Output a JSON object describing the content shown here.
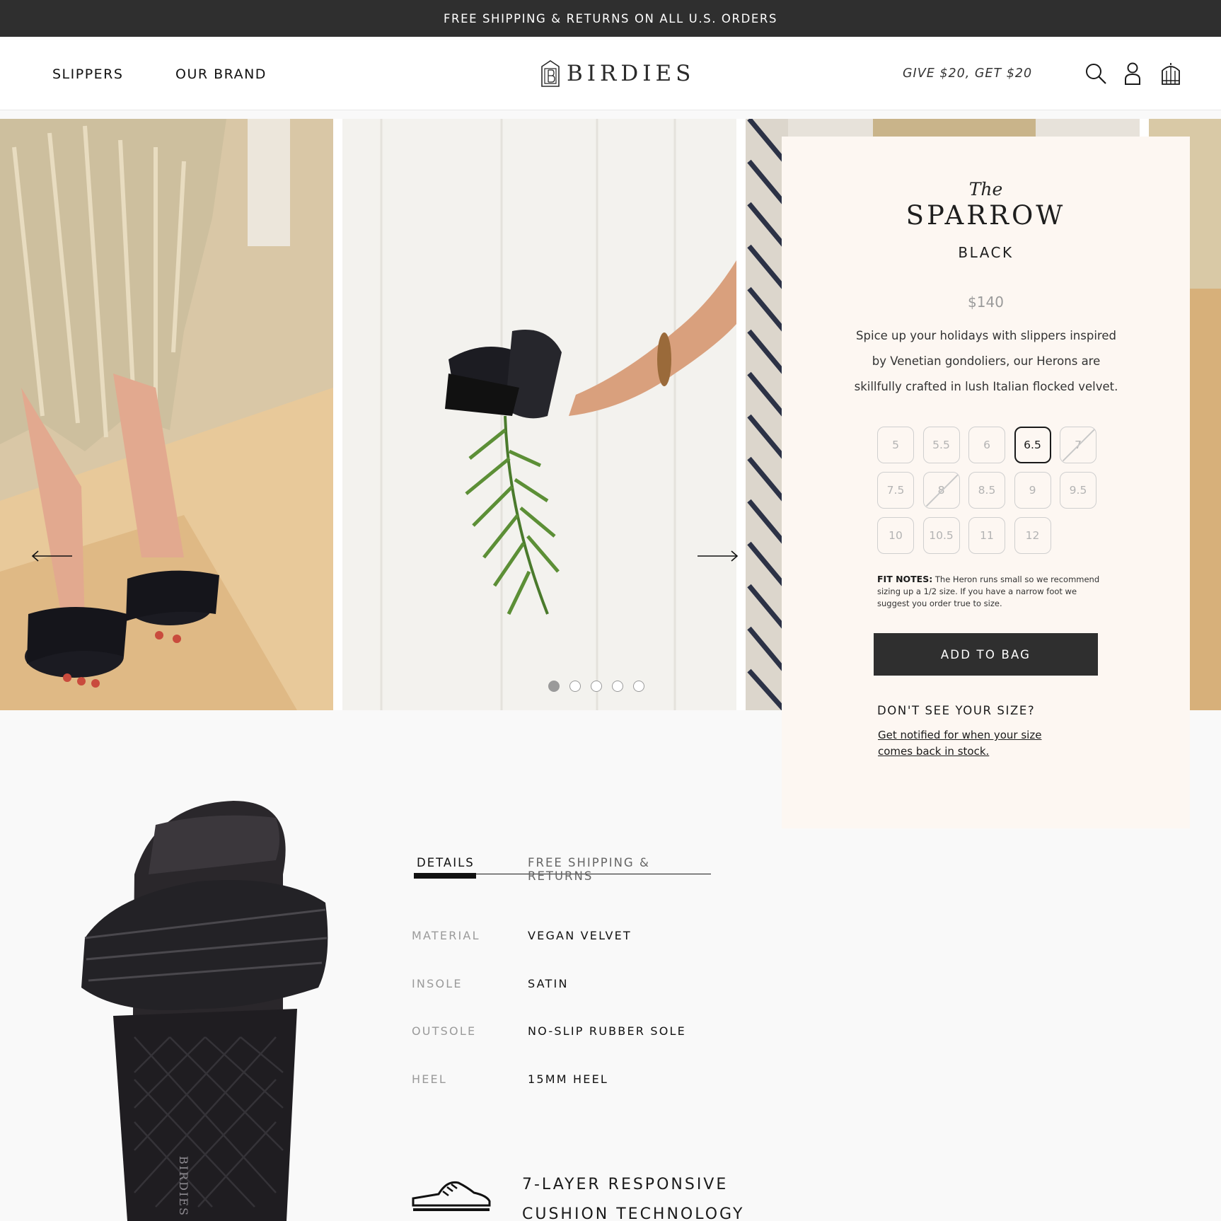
{
  "announcement": "FREE SHIPPING & RETURNS ON ALL U.S. ORDERS",
  "nav": {
    "slippers": "SLIPPERS",
    "our_brand": "OUR BRAND",
    "logo": "BIRDIES",
    "promo": "GIVE $20, GET $20",
    "icons": [
      "search-icon",
      "account-icon",
      "bag-icon"
    ]
  },
  "gallery": {
    "slide_count": 5,
    "active_slide": 1
  },
  "product": {
    "prefix": "The",
    "name": "SPARROW",
    "color": "BLACK",
    "price": "$140",
    "description": "Spice up your holidays with slippers inspired by Venetian gondoliers, our Herons are skillfully crafted in lush Italian flocked velvet.",
    "sizes": [
      {
        "label": "5",
        "state": "available"
      },
      {
        "label": "5.5",
        "state": "available"
      },
      {
        "label": "6",
        "state": "available"
      },
      {
        "label": "6.5",
        "state": "selected"
      },
      {
        "label": "7",
        "state": "sold-out"
      },
      {
        "label": "7.5",
        "state": "available"
      },
      {
        "label": "8",
        "state": "sold-out"
      },
      {
        "label": "8.5",
        "state": "available"
      },
      {
        "label": "9",
        "state": "available"
      },
      {
        "label": "9.5",
        "state": "available"
      },
      {
        "label": "10",
        "state": "available"
      },
      {
        "label": "10.5",
        "state": "available"
      },
      {
        "label": "11",
        "state": "available"
      },
      {
        "label": "12",
        "state": "available"
      }
    ],
    "fit_notes_label": "FIT NOTES:",
    "fit_notes": "The Heron runs small so we recommend sizing up a 1/2 size. If you have a narrow foot we suggest you order true to size.",
    "add_to_bag": "ADD TO BAG",
    "dont_see": "DON'T SEE YOUR SIZE?",
    "notify": "Get notified for when your size comes back in stock."
  },
  "details": {
    "tabs": [
      "DETAILS",
      "FREE SHIPPING & RETURNS"
    ],
    "specs": [
      {
        "label": "MATERIAL",
        "value": "VEGAN VELVET"
      },
      {
        "label": "INSOLE",
        "value": "SATIN"
      },
      {
        "label": "OUTSOLE",
        "value": "NO-SLIP RUBBER SOLE"
      },
      {
        "label": "HEEL",
        "value": "15MM HEEL"
      }
    ],
    "feature": "7-LAYER RESPONSIVE CUSHION TECHNOLOGY",
    "insole_logo": "BIRDIES"
  },
  "colors": {
    "dark": "#2f2f2f",
    "panel": "#fdf7f2",
    "muted": "#9a9a9a"
  }
}
